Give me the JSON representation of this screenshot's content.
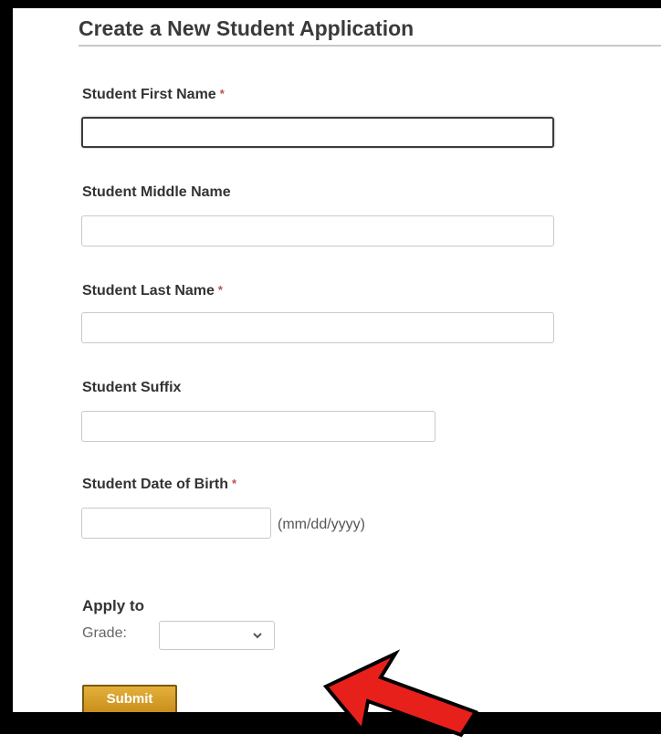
{
  "form": {
    "title": "Create a New Student Application",
    "required_marker": "*",
    "fields": [
      {
        "label": "Student First Name",
        "required": true,
        "value": "",
        "focused": true
      },
      {
        "label": "Student Middle Name",
        "required": false,
        "value": ""
      },
      {
        "label": "Student Last Name",
        "required": true,
        "value": ""
      },
      {
        "label": "Student Suffix",
        "required": false,
        "value": ""
      },
      {
        "label": "Student Date of Birth",
        "required": true,
        "value": "",
        "hint": "(mm/dd/yyyy)"
      }
    ],
    "apply": {
      "heading": "Apply to",
      "grade_label": "Grade:",
      "grade_value": ""
    },
    "submit_label": "Submit"
  },
  "icons": {
    "select_chevron": "chevron-down-icon",
    "annotation_arrow": "arrow-pointer-icon"
  },
  "colors": {
    "required": "#c0504d",
    "submit_bg": "#d9a12c",
    "arrow": "#e8201c",
    "frame": "#000000"
  }
}
